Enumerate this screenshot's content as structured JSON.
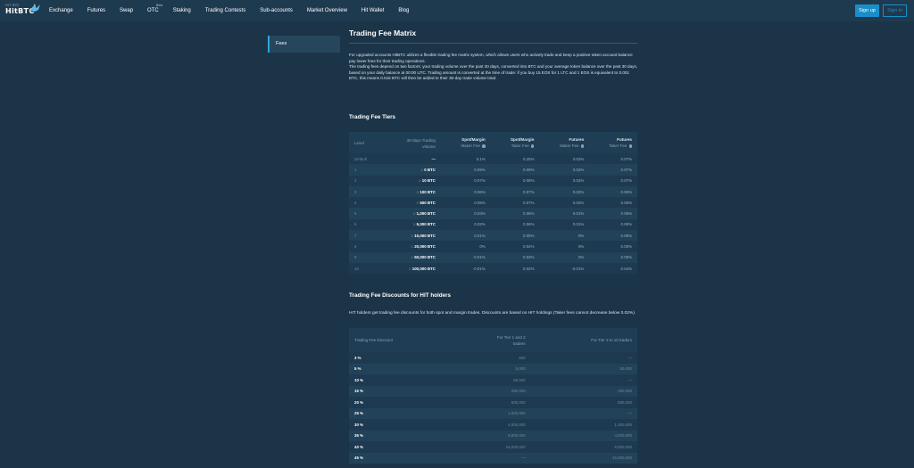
{
  "header": {
    "logo_small": "HIT BTC",
    "logo_main": "HitBTC",
    "nav": [
      {
        "label": "Exchange"
      },
      {
        "label": "Futures"
      },
      {
        "label": "Swap"
      },
      {
        "label": "OTC",
        "badge": "Beta"
      },
      {
        "label": "Staking"
      },
      {
        "label": "Trading Contests"
      },
      {
        "label": "Sub-accounts"
      },
      {
        "label": "Market Overview"
      },
      {
        "label": "Hit Wallet"
      },
      {
        "label": "Blog"
      }
    ],
    "signup": "Sign up",
    "signin": "Sign in"
  },
  "sidebar": {
    "items": [
      {
        "label": "Fees"
      }
    ]
  },
  "main": {
    "title": "Trading Fee Matrix",
    "intro": [
      "For upgraded accounts HitBTC utilizes a flexible trading fee matrix system, which allows users who actively trade and keep a positive token account balance pay lower fees for their trading operations.",
      "The trading fees depend on two factors: your trading volume over the past 30 days, converted into BTC and your average token balance over the past 30 days, based on your daily balance at 00:00 UTC. Trading amount is converted at the time of trade: if you buy 15 EOS for 1 LTC and 1 EOS is equivalent to 0.001 BTC, this means 0.015 BTC will then be added to their 30-day trade volume total."
    ],
    "tiers": {
      "title": "Trading Fee Tiers",
      "headers": {
        "level": "Level",
        "volume_1": "30-days Trading",
        "volume_2": "Volume",
        "spot_maker_1": "Spot/Margin",
        "spot_maker_2": "Maker Fee",
        "spot_taker_1": "Spot/Margin",
        "spot_taker_2": "Taker Fee",
        "fut_maker_1": "Futures",
        "fut_maker_2": "Maker Fee",
        "fut_taker_1": "Futures",
        "fut_taker_2": "Taker Fee"
      },
      "rows": [
        {
          "level": "Default",
          "ge": "",
          "volume": "—",
          "sm": "0.1%",
          "st": "0.25%",
          "fm": "0.02%",
          "ft": "0.07%"
        },
        {
          "level": "1",
          "ge": "≥",
          "volume": "0 BTC",
          "sm": "0.09%",
          "st": "0.09%",
          "fm": "0.02%",
          "ft": "0.07%"
        },
        {
          "level": "2",
          "ge": "≥",
          "volume": "10 BTC",
          "sm": "0.07%",
          "st": "0.08%",
          "fm": "0.02%",
          "ft": "0.07%"
        },
        {
          "level": "3",
          "ge": "≥",
          "volume": "100 BTC",
          "sm": "0.06%",
          "st": "0.07%",
          "fm": "0.02%",
          "ft": "0.06%"
        },
        {
          "level": "4",
          "ge": "≥",
          "volume": "500 BTC",
          "sm": "0.05%",
          "st": "0.07%",
          "fm": "0.02%",
          "ft": "0.06%"
        },
        {
          "level": "5",
          "ge": "≥",
          "volume": "1,000 BTC",
          "sm": "0.03%",
          "st": "0.06%",
          "fm": "0.01%",
          "ft": "0.05%"
        },
        {
          "level": "6",
          "ge": "≥",
          "volume": "5,000 BTC",
          "sm": "0.02%",
          "st": "0.06%",
          "fm": "0.01%",
          "ft": "0.05%"
        },
        {
          "level": "7",
          "ge": "≥",
          "volume": "10,000 BTC",
          "sm": "0.01%",
          "st": "0.05%",
          "fm": "0%",
          "ft": "0.05%"
        },
        {
          "level": "8",
          "ge": "≥",
          "volume": "20,000 BTC",
          "sm": "0%",
          "st": "0.04%",
          "fm": "0%",
          "ft": "0.05%"
        },
        {
          "level": "9",
          "ge": "≥",
          "volume": "50,000 BTC",
          "sm": "-0.01%",
          "st": "0.03%",
          "fm": "0%",
          "ft": "0.05%"
        },
        {
          "level": "10",
          "ge": "≥",
          "volume": "100,000 BTC",
          "sm": "-0.01%",
          "st": "0.02%",
          "fm": "-0.01%",
          "ft": "0.04%"
        }
      ]
    },
    "discounts": {
      "title": "Trading Fee Discounts for HIT holders",
      "text": "HIT holders get trading fee discounts for both spot and margin trades. Discounts are based on HIT holdings (Taker fees cannot decrease below 0.02%).",
      "headers": {
        "discount": "Trading Fee Discount",
        "tier12_1": "For Tier 1 and 2",
        "tier12_2": "traders",
        "tier310": "For Tier 3 to 10 traders"
      },
      "rows": [
        {
          "pct": "3 %",
          "t12": "500",
          "t310": "—"
        },
        {
          "pct": "5 %",
          "t12": "5,000",
          "t310": "50,000"
        },
        {
          "pct": "10 %",
          "t12": "50,000",
          "t310": "—"
        },
        {
          "pct": "15 %",
          "t12": "250,000",
          "t310": "250,000"
        },
        {
          "pct": "20 %",
          "t12": "500,000",
          "t310": "500,000"
        },
        {
          "pct": "25 %",
          "t12": "1,000,000",
          "t310": "—"
        },
        {
          "pct": "30 %",
          "t12": "4,000,000",
          "t310": "1,000,000"
        },
        {
          "pct": "35 %",
          "t12": "8,000,000",
          "t310": "4,000,000"
        },
        {
          "pct": "40 %",
          "t12": "16,000,000",
          "t310": "8,000,000"
        },
        {
          "pct": "45 %",
          "t12": "—",
          "t310": "16,000,000"
        }
      ]
    }
  }
}
